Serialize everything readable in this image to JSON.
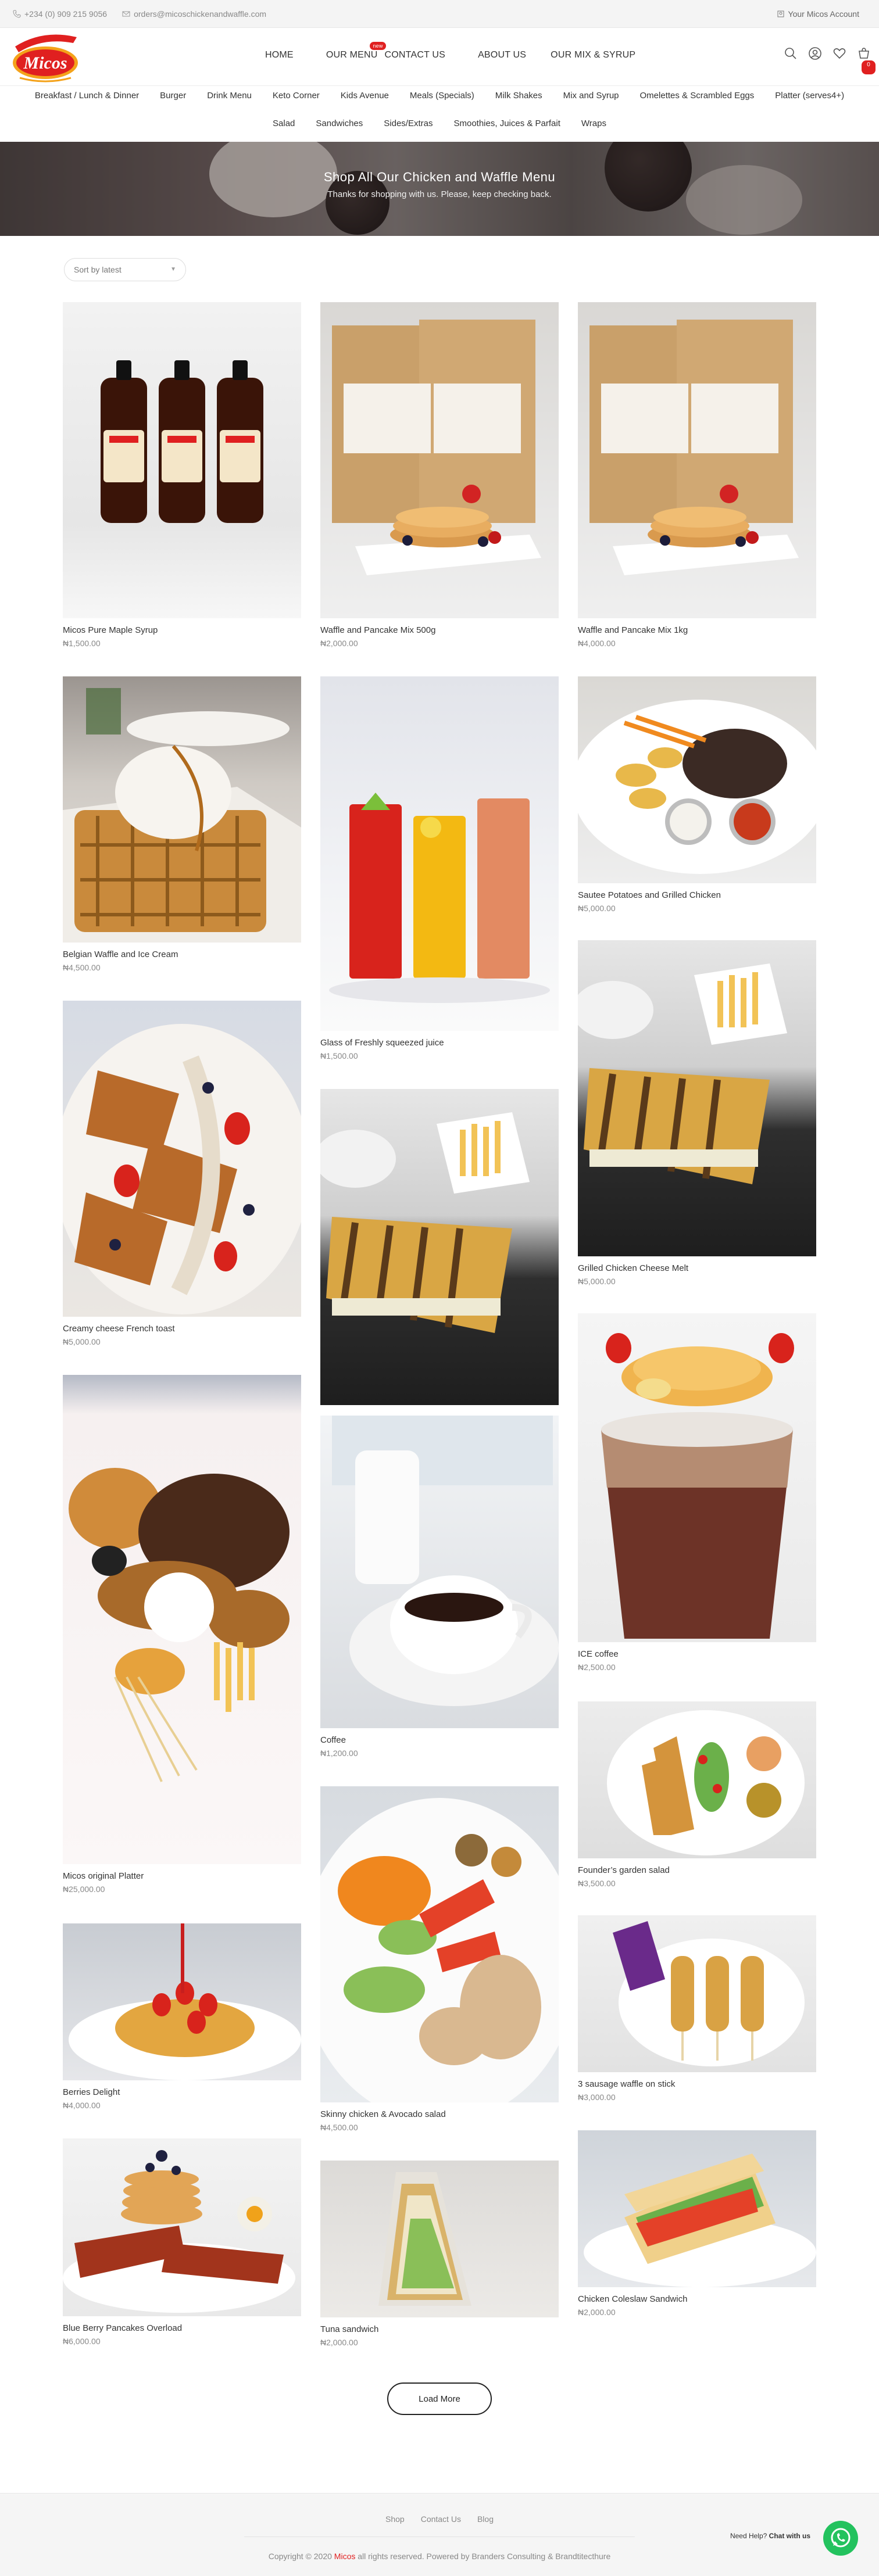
{
  "topbar": {
    "phone": "+234 (0) 909 215 9056",
    "email": "orders@micoschickenandwaffle.com",
    "account": "Your Micos Account"
  },
  "brand": {
    "logo_text": "Micos",
    "colors": {
      "accent": "#e02020",
      "logo_orange": "#f4a21a",
      "whatsapp": "#23c25e"
    }
  },
  "nav": {
    "items": [
      "HOME",
      "OUR MENU",
      "CONTACT US",
      "ABOUT US",
      "OUR MIX & SYRUP"
    ],
    "badge": "new"
  },
  "header_icons": [
    "search-icon",
    "user-icon",
    "heart-icon",
    "cart-icon"
  ],
  "cart_count": "0",
  "categories": {
    "row1": [
      "Breakfast / Lunch & Dinner",
      "Burger",
      "Drink Menu",
      "Keto Corner",
      "Kids Avenue",
      "Meals (Specials)",
      "Milk Shakes",
      "Mix and Syrup",
      "Omelettes & Scrambled Eggs",
      "Platter (serves4+)"
    ],
    "row2": [
      "Salad",
      "Sandwiches",
      "Sides/Extras",
      "Smoothies, Juices & Parfait",
      "Wraps"
    ]
  },
  "banner": {
    "title": "Shop All Our Chicken and Waffle Menu",
    "subtitle": "Thanks for shopping with us. Please, keep checking back."
  },
  "sort": {
    "value": "Sort by latest"
  },
  "products": [
    {
      "name": "Micos Pure Maple Syrup",
      "price": "₦1,500.00"
    },
    {
      "name": "Waffle and Pancake Mix 500g",
      "price": "₦2,000.00"
    },
    {
      "name": "Waffle and Pancake Mix 1kg",
      "price": "₦4,000.00"
    },
    {
      "name": "Belgian Waffle and Ice Cream",
      "price": "₦4,500.00"
    },
    {
      "name": "Glass of Freshly squeezed juice",
      "price": "₦1,500.00"
    },
    {
      "name": "Sautee Potatoes and Grilled Chicken",
      "price": "₦5,000.00"
    },
    {
      "name": "Creamy cheese French toast",
      "price": "₦5,000.00"
    },
    {
      "name": "Grilled Chicken Cheese Melt",
      "price": "₦5,000.00"
    },
    {
      "name": "Micos original Platter",
      "price": "₦25,000.00"
    },
    {
      "name": "Coffee",
      "price": "₦1,200.00"
    },
    {
      "name": "ICE coffee",
      "price": "₦2,500.00"
    },
    {
      "name": "Founder’s garden salad",
      "price": "₦3,500.00"
    },
    {
      "name": "Berries Delight",
      "price": "₦4,000.00"
    },
    {
      "name": "Skinny chicken & Avocado salad",
      "price": "₦4,500.00"
    },
    {
      "name": "3 sausage waffle on stick",
      "price": "₦3,000.00"
    },
    {
      "name": "Blue Berry Pancakes Overload",
      "price": "₦6,000.00"
    },
    {
      "name": "Tuna sandwich",
      "price": "₦2,000.00"
    },
    {
      "name": "Chicken Coleslaw Sandwich",
      "price": "₦2,000.00"
    }
  ],
  "load_more": "Load More",
  "footer": {
    "links": [
      "Shop",
      "Contact Us",
      "Blog"
    ],
    "copyright_pre": "Copyright © 2020",
    "copyright_brand": "Micos",
    "copyright_post": "all rights reserved. Powered by Branders Consulting & Brandtitecthure"
  },
  "help": {
    "prefix": "Need Help?",
    "action": "Chat with us"
  }
}
